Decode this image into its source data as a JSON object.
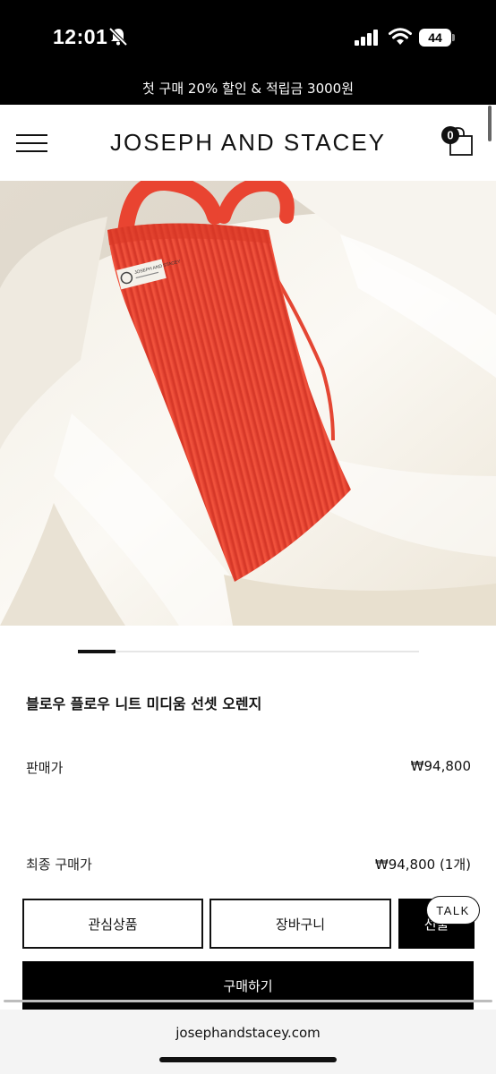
{
  "status_bar": {
    "time": "12:01",
    "battery": "44"
  },
  "promo_banner": "첫 구매 20% 할인 & 적립금 3000원",
  "header": {
    "logo": "JOSEPH AND STACEY",
    "cart_count": "0"
  },
  "hero": {
    "tag_text": "JOSEPH AND STACEY"
  },
  "slider": {
    "active_index": 1
  },
  "product": {
    "name": "블로우 플로우 니트 미디움 선셋 오렌지",
    "price_label": "판매가",
    "price_value": "₩94,800",
    "final_label": "최종 구매가",
    "final_value": "₩94,800 (1개)"
  },
  "buttons": {
    "wishlist": "관심상품",
    "cart": "장바구니",
    "third_partial": "선물",
    "buy": "구매하기",
    "talk": "TALK"
  },
  "browser": {
    "url": "josephandstacey.com"
  },
  "colors": {
    "bag": "#ef4a36",
    "black": "#000000",
    "cream": "#f1ebdf"
  }
}
